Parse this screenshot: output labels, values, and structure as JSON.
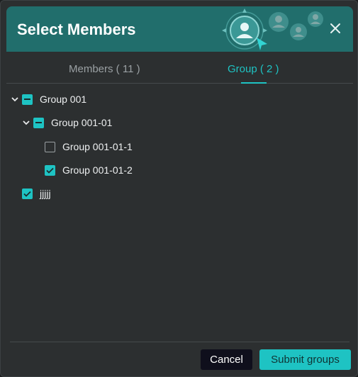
{
  "dialog": {
    "title": "Select Members",
    "close_icon": "close-icon"
  },
  "tabs": {
    "members_label": "Members ( 11 )",
    "group_label": "Group ( 2 )",
    "active": "group"
  },
  "tree": [
    {
      "label": "Group 001",
      "state": "indeterminate",
      "expanded": true
    },
    {
      "label": "Group 001-01",
      "state": "indeterminate",
      "expanded": true
    },
    {
      "label": "Group 001-01-1",
      "state": "unchecked"
    },
    {
      "label": "Group 001-01-2",
      "state": "checked"
    },
    {
      "label": "jjjjj",
      "state": "checked"
    }
  ],
  "footer": {
    "cancel_label": "Cancel",
    "submit_label": "Submit groups"
  },
  "colors": {
    "accent": "#1ec3c3",
    "header": "#216e6c",
    "background": "#2c2f30"
  }
}
